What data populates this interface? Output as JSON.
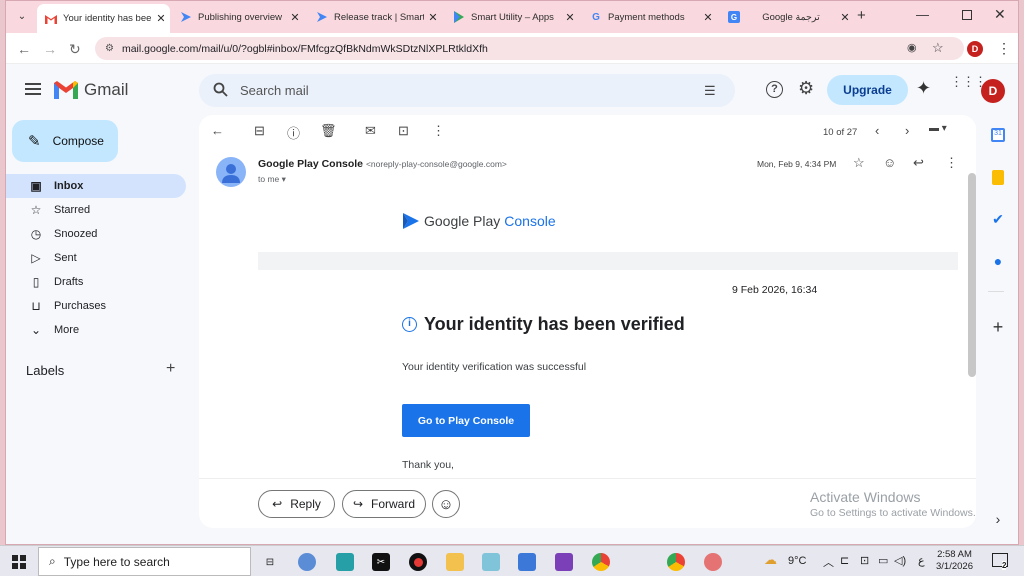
{
  "browser": {
    "tabs": [
      {
        "title": "Your identity has bee",
        "icon": "gmail-icon",
        "active": true
      },
      {
        "title": "Publishing overview",
        "icon": "play-console-icon",
        "active": false
      },
      {
        "title": "Release track | Smart",
        "icon": "play-console-icon",
        "active": false
      },
      {
        "title": "Smart Utility – Apps",
        "icon": "google-play-icon",
        "active": false
      },
      {
        "title": "Payment methods",
        "icon": "google-icon",
        "active": false
      },
      {
        "title": "Google ترجمة",
        "icon": "google-translate-icon",
        "active": false
      }
    ],
    "url": "mail.google.com/mail/u/0/?ogbl#inbox/FMfcgzQfBkNdmWkSDtzNlXPLRtkldXfh",
    "profile_initial": "D"
  },
  "gmail": {
    "app_name": "Gmail",
    "search_placeholder": "Search mail",
    "upgrade_label": "Upgrade",
    "account_initial": "D",
    "compose_label": "Compose",
    "nav": [
      {
        "label": "Inbox",
        "icon": "inbox-icon",
        "selected": true
      },
      {
        "label": "Starred",
        "icon": "star-icon",
        "selected": false
      },
      {
        "label": "Snoozed",
        "icon": "clock-icon",
        "selected": false
      },
      {
        "label": "Sent",
        "icon": "send-icon",
        "selected": false
      },
      {
        "label": "Drafts",
        "icon": "draft-icon",
        "selected": false
      },
      {
        "label": "Purchases",
        "icon": "bag-icon",
        "selected": false
      },
      {
        "label": "More",
        "icon": "chevron-down-icon",
        "selected": false
      }
    ],
    "labels_heading": "Labels",
    "pagination": "10 of 27"
  },
  "email": {
    "sender_name": "Google Play Console",
    "sender_email": "<noreply-play-console@google.com>",
    "recipient": "to me",
    "date": "Mon, Feb 9, 4:34 PM",
    "brand_google": "Google Play",
    "brand_console": "Console",
    "timestamp": "9 Feb 2026, 16:34",
    "heading": "Your identity has been verified",
    "body": "Your identity verification was successful",
    "cta_label": "Go to Play Console",
    "closing": "Thank you,",
    "reply_label": "Reply",
    "forward_label": "Forward"
  },
  "watermark": {
    "title": "Activate Windows",
    "subtitle": "Go to Settings to activate Windows."
  },
  "taskbar": {
    "search_placeholder": "Type here to search",
    "weather": "9°C",
    "language": "ع",
    "time": "2:58 AM",
    "date": "3/1/2026",
    "notification_count": "2"
  },
  "colors": {
    "accent_blue": "#1a73e8",
    "gmail_red": "#ea4335",
    "chip_blue": "#c2e7ff"
  }
}
